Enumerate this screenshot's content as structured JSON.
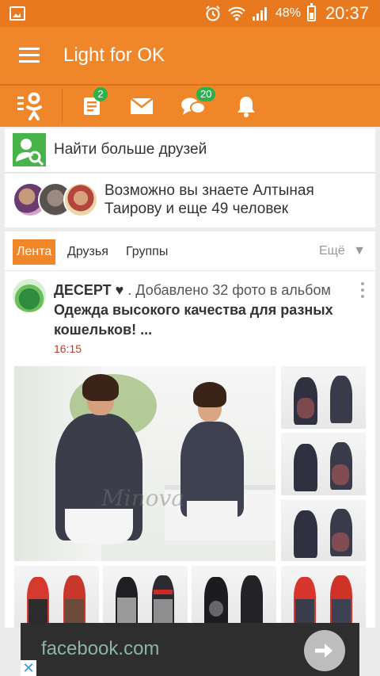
{
  "status_bar": {
    "battery": "48%",
    "time": "20:37"
  },
  "app_bar": {
    "title": "Light for OK"
  },
  "toolbar": {
    "events_badge": "2",
    "discussions_badge": "20"
  },
  "find_friends": {
    "label": "Найти больше друзей"
  },
  "suggestions": {
    "text": "Возможно вы знаете Алтыная Таирову и еще 49 человек"
  },
  "feed": {
    "tabs": [
      "Лента",
      "Друзья",
      "Группы"
    ],
    "more_label": "Ещё",
    "post": {
      "author": "ДЕСЕРТ ♥",
      "action": " . Добавлено 32 фото в альбом ",
      "album": "Одежда высокого качества для разных кошельков! ...",
      "time": "16:15",
      "watermark": "Minova"
    }
  },
  "ad": {
    "text": "facebook.com"
  },
  "colors": {
    "accent": "#f0862a",
    "status_bar": "#e8791f",
    "badge": "#2bb24c",
    "find_icon": "#47b44a",
    "time_red": "#c0392b"
  }
}
